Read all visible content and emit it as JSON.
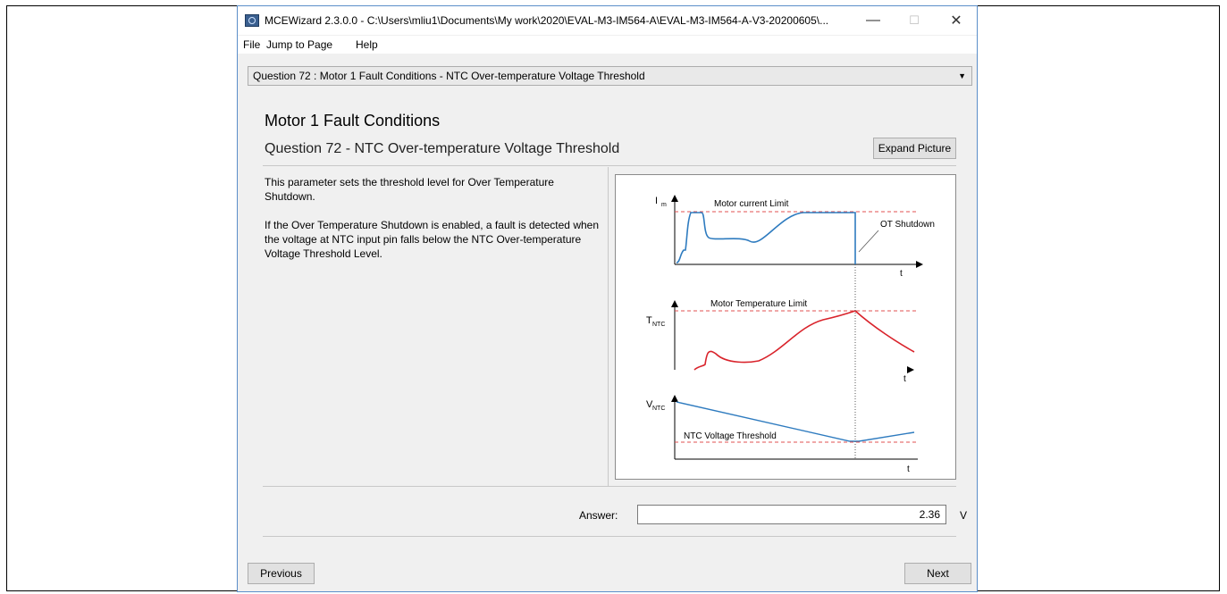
{
  "window": {
    "title": "MCEWizard 2.3.0.0  - C:\\Users\\mliu1\\Documents\\My work\\2020\\EVAL-M3-IM564-A\\EVAL-M3-IM564-A-V3-20200605\\...",
    "minimize_glyph": "—",
    "maximize_glyph": "☐",
    "close_glyph": "✕"
  },
  "menu": {
    "items": [
      "File",
      "Jump to Page",
      "Help"
    ]
  },
  "question_select": {
    "value": "Question  72 : Motor 1 Fault Conditions - NTC Over-temperature Voltage Threshold"
  },
  "section": {
    "title": "Motor 1 Fault Conditions",
    "question": "Question 72 - NTC Over-temperature Voltage Threshold",
    "expand_label": "Expand Picture"
  },
  "description": {
    "para1": "This parameter sets the threshold level for Over Temperature Shutdown.",
    "para2": "If the Over Temperature Shutdown is enabled, a fault is detected when the voltage at NTC input pin falls below the NTC Over-temperature Voltage Threshold Level."
  },
  "figure": {
    "plot1_ylabel": "I",
    "plot1_ylabel_sub": "m",
    "plot1_limit_label": "Motor current Limit",
    "plot1_annotation": "OT Shutdown",
    "plot2_ylabel": "T",
    "plot2_ylabel_sub": "NTC",
    "plot2_limit_label": "Motor Temperature Limit",
    "plot3_ylabel": "V",
    "plot3_ylabel_sub": "NTC",
    "plot3_limit_label": "NTC Voltage Threshold",
    "xlabel": "t",
    "current_color": "#2e7bbf",
    "temp_color": "#d9232b",
    "limit_color": "#e05050"
  },
  "answer": {
    "label": "Answer:",
    "value": "2.36",
    "unit": "V"
  },
  "nav": {
    "previous": "Previous",
    "next": "Next"
  }
}
